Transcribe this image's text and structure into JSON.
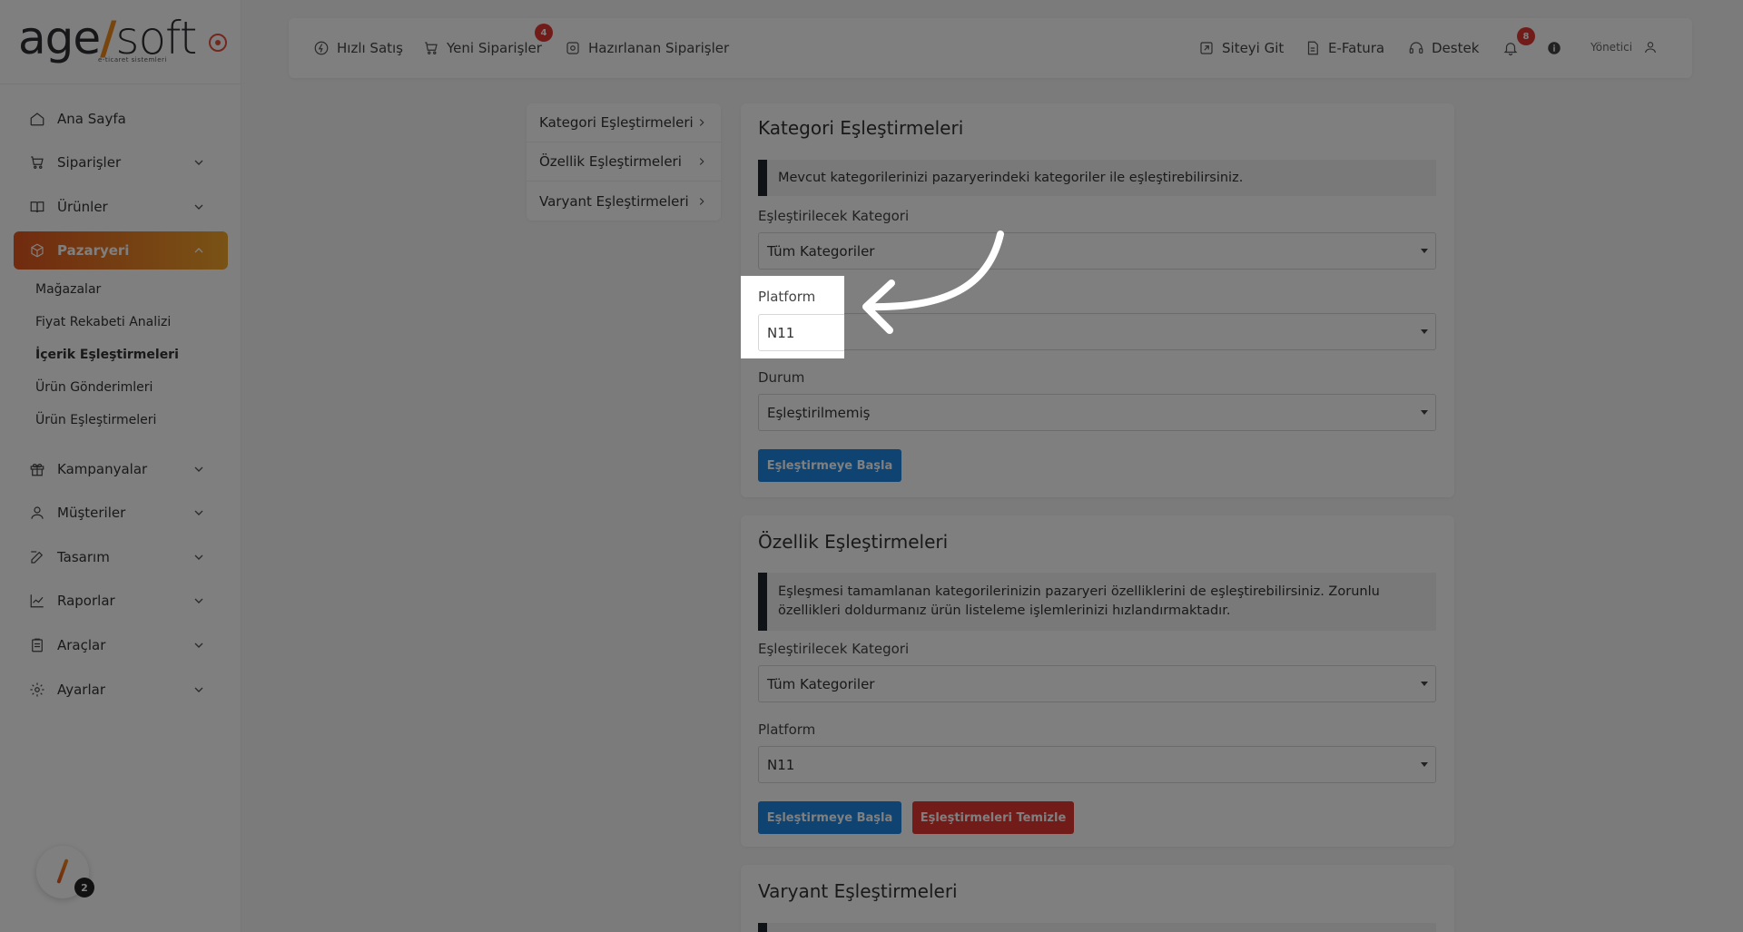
{
  "sidebar": {
    "logo": {
      "main_left": "age",
      "main_slash": "/",
      "main_right": "soft",
      "tagline": "e-ticaret sistemleri"
    },
    "items": [
      {
        "label": "Ana Sayfa",
        "icon": "home-icon"
      },
      {
        "label": "Siparişler",
        "icon": "cart-icon"
      },
      {
        "label": "Ürünler",
        "icon": "book-icon"
      },
      {
        "label": "Pazaryeri",
        "icon": "box-icon"
      },
      {
        "label": "Kampanyalar",
        "icon": "gift-icon"
      },
      {
        "label": "Müşteriler",
        "icon": "user-icon"
      },
      {
        "label": "Tasarım",
        "icon": "edit-icon"
      },
      {
        "label": "Raporlar",
        "icon": "chart-icon"
      },
      {
        "label": "Araçlar",
        "icon": "clipboard-icon"
      },
      {
        "label": "Ayarlar",
        "icon": "gear-icon"
      }
    ],
    "subitems": [
      "Mağazalar",
      "Fiyat Rekabeti Analizi",
      "İçerik Eşleştirmeleri",
      "Ürün Gönderimleri",
      "Ürün Eşleştirmeleri"
    ],
    "help_badge": "2"
  },
  "topbar": {
    "quick_sale": "Hızlı Satış",
    "new_orders": "Yeni Siparişler",
    "new_orders_badge": "4",
    "preparing_orders": "Hazırlanan Siparişler",
    "go_site": "Siteyi Git",
    "einvoice": "E-Fatura",
    "support": "Destek",
    "notif_badge": "8",
    "user": "Yönetici"
  },
  "submenu": [
    "Kategori Eşleştirmeleri",
    "Özellik Eşleştirmeleri",
    "Varyant Eşleştirmeleri"
  ],
  "category_card": {
    "title": "Kategori Eşleştirmeleri",
    "info": "Mevcut kategorilerinizi pazaryerindeki kategoriler ile eşleştirebilirsiniz.",
    "category_label": "Eşleştirilecek Kategori",
    "category_value": "Tüm Kategoriler",
    "platform_label": "Platform",
    "platform_value": "N11",
    "status_label": "Durum",
    "status_value": "Eşleştirilmemiş",
    "start_button": "Eşleştirmeye Başla"
  },
  "feature_card": {
    "title": "Özellik Eşleştirmeleri",
    "info": "Eşleşmesi tamamlanan kategorilerinizin pazaryeri özelliklerini de eşleştirebilirsiniz. Zorunlu özellikleri doldurmanız ürün listeleme işlemlerinizi hızlandırmaktadır.",
    "category_label": "Eşleştirilecek Kategori",
    "category_value": "Tüm Kategoriler",
    "platform_label": "Platform",
    "platform_value": "N11",
    "start_button": "Eşleştirmeye Başla",
    "clear_button": "Eşleştirmeleri Temizle"
  },
  "variant_card": {
    "title": "Varyant Eşleştirmeleri"
  },
  "colors": {
    "accent_gradient_start": "#e2561f",
    "accent_gradient_end": "#f3a52b",
    "primary_button": "#1e88e5",
    "danger_button": "#e53935"
  }
}
